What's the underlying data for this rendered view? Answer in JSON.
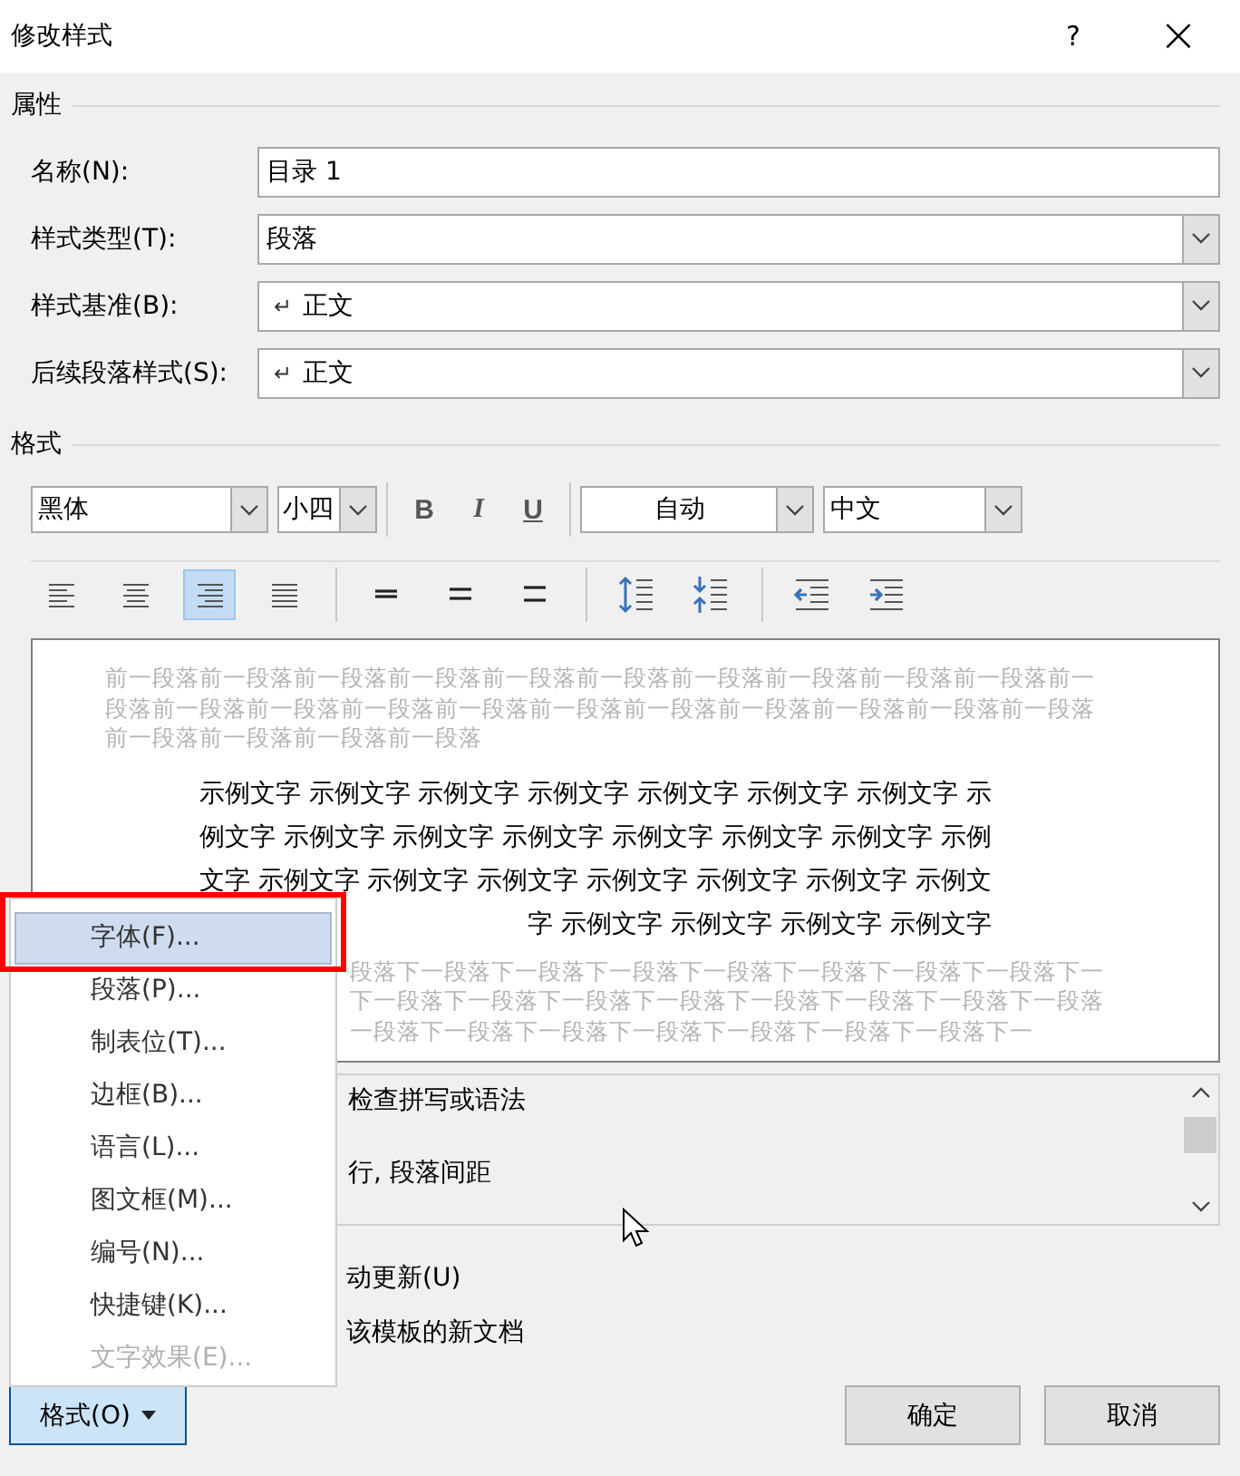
{
  "window": {
    "title": "修改样式",
    "help": "?",
    "close": "×"
  },
  "properties": {
    "heading": "属性",
    "fields": [
      {
        "kind": "text",
        "label": "名称(N):",
        "value": "目录 1"
      },
      {
        "kind": "dropdown",
        "label": "样式类型(T):",
        "value": "段落"
      },
      {
        "kind": "dropdown",
        "label": "样式基准(B):",
        "symbol": "↵",
        "value": "正文"
      },
      {
        "kind": "dropdown",
        "label": "后续段落样式(S):",
        "symbol": "↵",
        "value": "正文"
      }
    ]
  },
  "format": {
    "heading": "格式",
    "font": "黑体",
    "size": "小四",
    "bold": "B",
    "italic": "I",
    "underline": "U",
    "font_colour": "自动",
    "script": "中文",
    "alignment": [
      {
        "kind": "left",
        "selected": false
      },
      {
        "kind": "center",
        "selected": false
      },
      {
        "kind": "right",
        "selected": true
      },
      {
        "kind": "justify",
        "selected": false
      }
    ]
  },
  "preview": {
    "previous": [
      "前一段落前一段落前一段落前一段落前一段落前一段落前一段落前一段落前一段落前一段落前一",
      "段落前一段落前一段落前一段落前一段落前一段落前一段落前一段落前一段落前一段落前一段落",
      "前一段落前一段落前一段落前一段落"
    ],
    "sample": [
      "示例文字 示例文字 示例文字 示例文字 示例文字 示例文字 示例文字 示",
      "例文字 示例文字 示例文字 示例文字 示例文字 示例文字 示例文字 示例",
      "文字 示例文字 示例文字 示例文字 示例文字 示例文字 示例文字 示例文",
      "字 示例文字 示例文字 示例文字 示例文字"
    ],
    "next": [
      "段落下一段落下一段落下一段落下一段落下一段落下一段落下一段落下一",
      "下一段落下一段落下一段落下一段落下一段落下一段落下一段落下一段落",
      "一段落下一段落下一段落下一段落下一段落下一段落下一段落下一"
    ]
  },
  "description": [
    "检查拼写或语法",
    "行, 段落间距"
  ],
  "options": [
    "动更新(U)",
    "该模板的新文档"
  ],
  "menu": {
    "items": [
      {
        "label": "字体(F)...",
        "selected": true,
        "disabled": false
      },
      {
        "label": "段落(P)...",
        "selected": false,
        "disabled": false
      },
      {
        "label": "制表位(T)...",
        "selected": false,
        "disabled": false
      },
      {
        "label": "边框(B)...",
        "selected": false,
        "disabled": false
      },
      {
        "label": "语言(L)...",
        "selected": false,
        "disabled": false
      },
      {
        "label": "图文框(M)...",
        "selected": false,
        "disabled": false
      },
      {
        "label": "编号(N)...",
        "selected": false,
        "disabled": false
      },
      {
        "label": "快捷键(K)...",
        "selected": false,
        "disabled": false
      },
      {
        "label": "文字效果(E)...",
        "selected": false,
        "disabled": true
      }
    ]
  },
  "format_button": {
    "label": "格式(O)",
    "pressed": true
  },
  "buttons": [
    "确定",
    "取消"
  ]
}
